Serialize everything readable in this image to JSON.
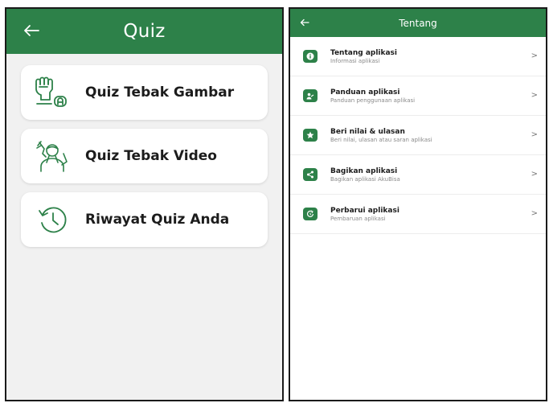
{
  "left_screen": {
    "title": "Quiz",
    "items": [
      {
        "label": "Quiz Tebak Gambar",
        "icon": "hand-sign-icon"
      },
      {
        "label": "Quiz Tebak Video",
        "icon": "person-signing-icon"
      },
      {
        "label": "Riwayat Quiz Anda",
        "icon": "history-icon"
      }
    ]
  },
  "right_screen": {
    "title": "Tentang",
    "items": [
      {
        "title": "Tentang aplikasi",
        "subtitle": "Informasi aplikasi",
        "icon": "info-icon",
        "chevron": ">"
      },
      {
        "title": "Panduan aplikasi",
        "subtitle": "Panduan penggunaan aplikasi",
        "icon": "guide-icon",
        "chevron": ">"
      },
      {
        "title": "Beri nilai & ulasan",
        "subtitle": "Beri nilai, ulasan atau saran aplikasi",
        "icon": "star-icon",
        "chevron": ">"
      },
      {
        "title": "Bagikan aplikasi",
        "subtitle": "Bagikan aplikasi AkuBisa",
        "icon": "share-icon",
        "chevron": ">"
      },
      {
        "title": "Perbarui aplikasi",
        "subtitle": "Pembaruan aplikasi",
        "icon": "update-icon",
        "chevron": ">"
      }
    ]
  },
  "colors": {
    "brand": "#2d8149",
    "background": "#f1f1f1"
  }
}
